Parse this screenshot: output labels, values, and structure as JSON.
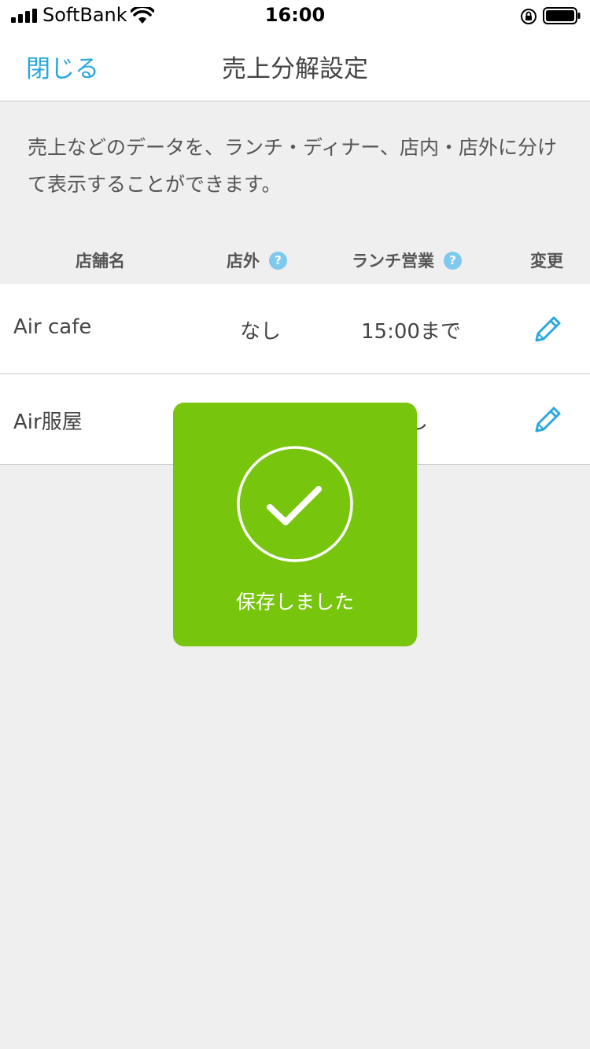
{
  "status_bar": {
    "carrier": "SoftBank",
    "time": "16:00"
  },
  "nav": {
    "close_label": "閉じる",
    "title": "売上分解設定"
  },
  "description": "売上などのデータを、ランチ・ディナー、店内・店外に分けて表示することができます。",
  "table": {
    "headers": {
      "store_name": "店舗名",
      "outside": "店外",
      "lunch": "ランチ営業",
      "change": "変更",
      "help_glyph": "?"
    },
    "rows": [
      {
        "store": "Air cafe",
        "outside": "なし",
        "lunch": "15:00まで"
      },
      {
        "store": "Air服屋",
        "outside": "",
        "lunch": "なし"
      }
    ]
  },
  "toast": {
    "message": "保存しました",
    "icon": "check-circle-icon"
  },
  "colors": {
    "accent": "#2aa7dd",
    "toast_bg": "#77c50c",
    "background": "#efefef",
    "help_icon": "#7fc9ee"
  }
}
